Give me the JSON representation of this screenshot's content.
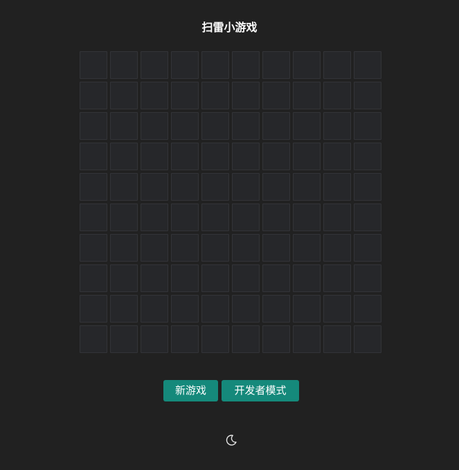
{
  "header": {
    "title": "扫雷小游戏"
  },
  "board": {
    "rows": 10,
    "columns": 10,
    "state": "all cells unrevealed"
  },
  "controls": {
    "new_game_label": "新游戏",
    "developer_mode_label": "开发者模式"
  },
  "theme_toggle": {
    "icon": "moon-icon",
    "mode": "dark"
  },
  "colors": {
    "background": "#212121",
    "cell": "#26272a",
    "cell_border": "#333438",
    "button": "#15897b",
    "text": "#ffffff"
  }
}
